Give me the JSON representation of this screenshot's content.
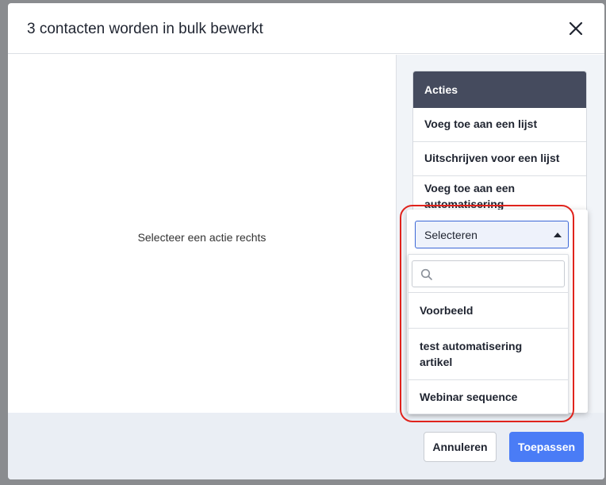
{
  "modal": {
    "title": "3 contacten worden in bulk bewerkt",
    "placeholder": "Selecteer een actie rechts"
  },
  "actions": {
    "header": "Acties",
    "items": [
      {
        "label": "Voeg toe aan een lijst"
      },
      {
        "label": "Uitschrijven voor een lijst"
      },
      {
        "label": "Voeg toe aan een automatisering"
      }
    ]
  },
  "dropdown": {
    "selected": "Selecteren",
    "search_value": "",
    "options": [
      {
        "label": "Voorbeeld"
      },
      {
        "label": "test automatisering artikel"
      },
      {
        "label": "Webinar sequence"
      }
    ]
  },
  "footer": {
    "cancel_label": "Annuleren",
    "apply_label": "Toepassen"
  },
  "colors": {
    "accent": "#4a7cf6",
    "header_dark": "#454b5e",
    "highlight": "#e0231c"
  }
}
